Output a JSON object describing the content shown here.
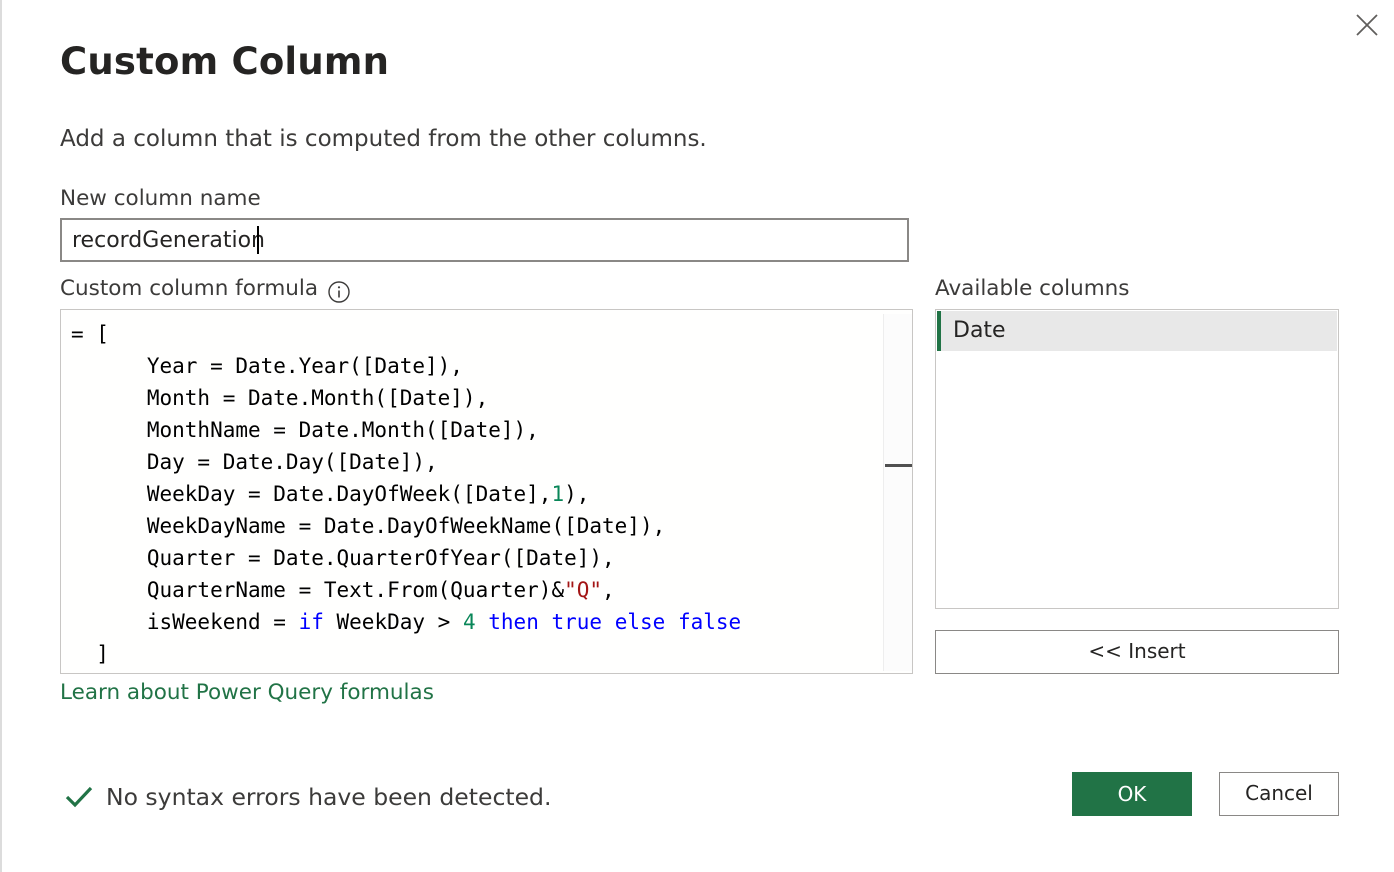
{
  "dialog": {
    "title": "Custom Column",
    "description": "Add a column that is computed from the other columns."
  },
  "name_field": {
    "label": "New column name",
    "value": "recordGeneration"
  },
  "formula": {
    "label": "Custom column formula",
    "info_icon": "info-icon",
    "lines": [
      "= [",
      "Year = Date.Year([Date]),",
      "Month = Date.Month([Date]),",
      "MonthName = Date.Month([Date]),",
      "Day = Date.Day([Date]),",
      "WeekDay = Date.DayOfWeek([Date],1),",
      "WeekDayName = Date.DayOfWeekName([Date]),",
      "Quarter = Date.QuarterOfYear([Date]),",
      "QuarterName = Text.From(Quarter)&\"Q\",",
      "isWeekend = if WeekDay > 4 then true else false",
      "]"
    ]
  },
  "available_columns": {
    "label": "Available columns",
    "items": [
      "Date"
    ]
  },
  "buttons": {
    "insert": "<< Insert",
    "ok": "OK",
    "cancel": "Cancel"
  },
  "learn_link": "Learn about Power Query formulas",
  "status": {
    "icon": "checkmark-icon",
    "text": "No syntax errors have been detected."
  },
  "colors": {
    "accent": "#217346",
    "keyword": "#0000ff",
    "number": "#098658",
    "string": "#a31515"
  }
}
